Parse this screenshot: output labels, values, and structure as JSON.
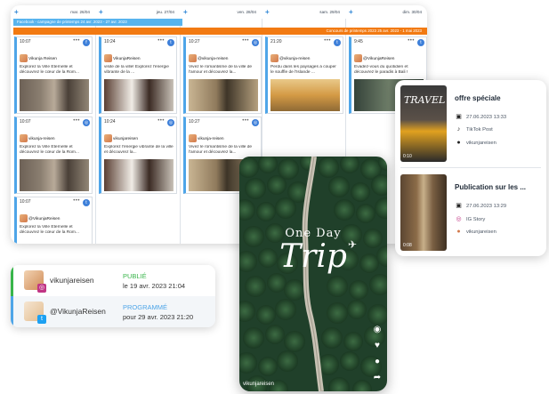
{
  "calendar": {
    "days": [
      "mar. 26/04",
      "jeu. 27/04",
      "ven. 28/04",
      "sam. 29/04",
      "dim. 30/04"
    ],
    "campaign_band": "Facebook - campagne de printemps 24 avr. 2023 - 27 avr. 2023",
    "contest_band": "Concours de printemps 2023 25 avr. 2023 - 1 mai 2023",
    "cards": [
      {
        "time": "10:07",
        "account": "Vikunja Reisen",
        "text": "Explorez la Ville Éternelle et découvrez le cœur de la Rom..."
      },
      {
        "time": "10:24",
        "account": "VikunjaReisen",
        "text": "visite de la ville! Explorez l'énergie vibrante de la ..."
      },
      {
        "time": "10:27",
        "account": "@vikunja-reisen",
        "text": "Vivez le romantisme de la ville de l'amour et découvrez la..."
      },
      {
        "time": "21:20",
        "account": "@vikunja-reisen",
        "text": "Perdu dans les paysages à couper le souffle de l'Islande ..."
      },
      {
        "time": "9:45",
        "account": "@VikunjaReisen",
        "text": "Évadez-vous du quotidien et découvrez le paradis à Bali !"
      },
      {
        "time": "10:07",
        "account": "vikunja-reisen",
        "text": "Explorez la Ville Éternelle et découvrez le cœur de la Rom..."
      },
      {
        "time": "10:24",
        "account": "vikunjareisen",
        "text": "Explorez l'énergie vibrante de la ville et découvrez la..."
      },
      {
        "time": "10:27",
        "account": "vikunja-reisen",
        "text": "Vivez le romantisme de la ville de l'amour et découvrez la..."
      },
      {
        "time": "10:07",
        "account": "@VikunjaReisen",
        "text": "Explorez la Ville Éternelle et découvrez le cœur de la Rom..."
      }
    ]
  },
  "preview": {
    "items": [
      {
        "title": "offre spéciale",
        "date": "27.06.2023 13:33",
        "channel": "TikTok Post",
        "account": "vikunjareisen",
        "thumb_text": "TRAVEL",
        "duration": "0:10"
      },
      {
        "title": "Publication sur les ...",
        "date": "27.06.2023 13:29",
        "channel": "IG Story",
        "account": "vikunjareisen",
        "duration": "0:08"
      }
    ]
  },
  "status": {
    "rows": [
      {
        "name": "vikunjareisen",
        "state": "PUBLIÉ",
        "date": "le 19 avr. 2023 21:04",
        "state_color": "#38b54a"
      },
      {
        "name": "@VikunjaReisen",
        "state": "PROGRAMMÉ",
        "date": "pour 29 avr. 2023 21:20",
        "state_color": "#4ea5e8"
      }
    ]
  },
  "story": {
    "line1": "One Day",
    "line2": "Trip",
    "account": "vikunjareisen"
  },
  "colors": {
    "accent_blue": "#3d7fd9",
    "orange": "#f27a12",
    "published_green": "#38b54a"
  }
}
